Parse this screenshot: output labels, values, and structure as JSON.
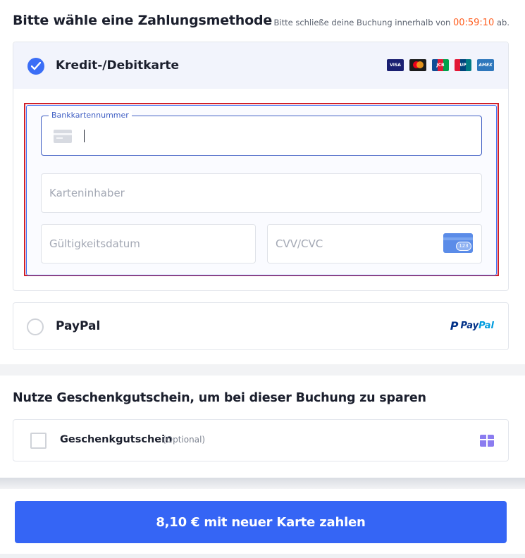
{
  "header": {
    "title": "Bitte wähle eine Zahlungsmethode",
    "timer_prefix": "Bitte schließe deine Buchung innerhalb von",
    "timer_value": "00:59:10",
    "timer_suffix": "ab."
  },
  "card_method": {
    "label": "Kredit-/Debitkarte",
    "selected": true,
    "brands": [
      {
        "name": "visa",
        "text": "VISA"
      },
      {
        "name": "mastercard",
        "text": ""
      },
      {
        "name": "jcb",
        "text": "JCB"
      },
      {
        "name": "unionpay",
        "text": "UP"
      },
      {
        "name": "amex",
        "text": "AMEX"
      }
    ],
    "fields": {
      "card_number": {
        "label": "Bankkartennummer",
        "value": ""
      },
      "card_holder": {
        "placeholder": "Karteninhaber"
      },
      "expiry": {
        "placeholder": "Gültigkeitsdatum"
      },
      "cvv": {
        "placeholder": "CVV/CVC",
        "icon_text": "123"
      }
    }
  },
  "paypal_method": {
    "label": "PayPal",
    "selected": false,
    "logo_pay": "Pay",
    "logo_pal": "Pal"
  },
  "voucher": {
    "title": "Nutze Geschenkgutschein, um bei dieser Buchung zu sparen",
    "label": "Geschenkgutschein",
    "optional": "(Optional)",
    "checked": false
  },
  "pay_button": {
    "label": "8,10 € mit neuer Karte zahlen"
  },
  "colors": {
    "accent": "#3565f5",
    "timer": "#ff5e1f",
    "highlight_outline": "#d0202a"
  }
}
